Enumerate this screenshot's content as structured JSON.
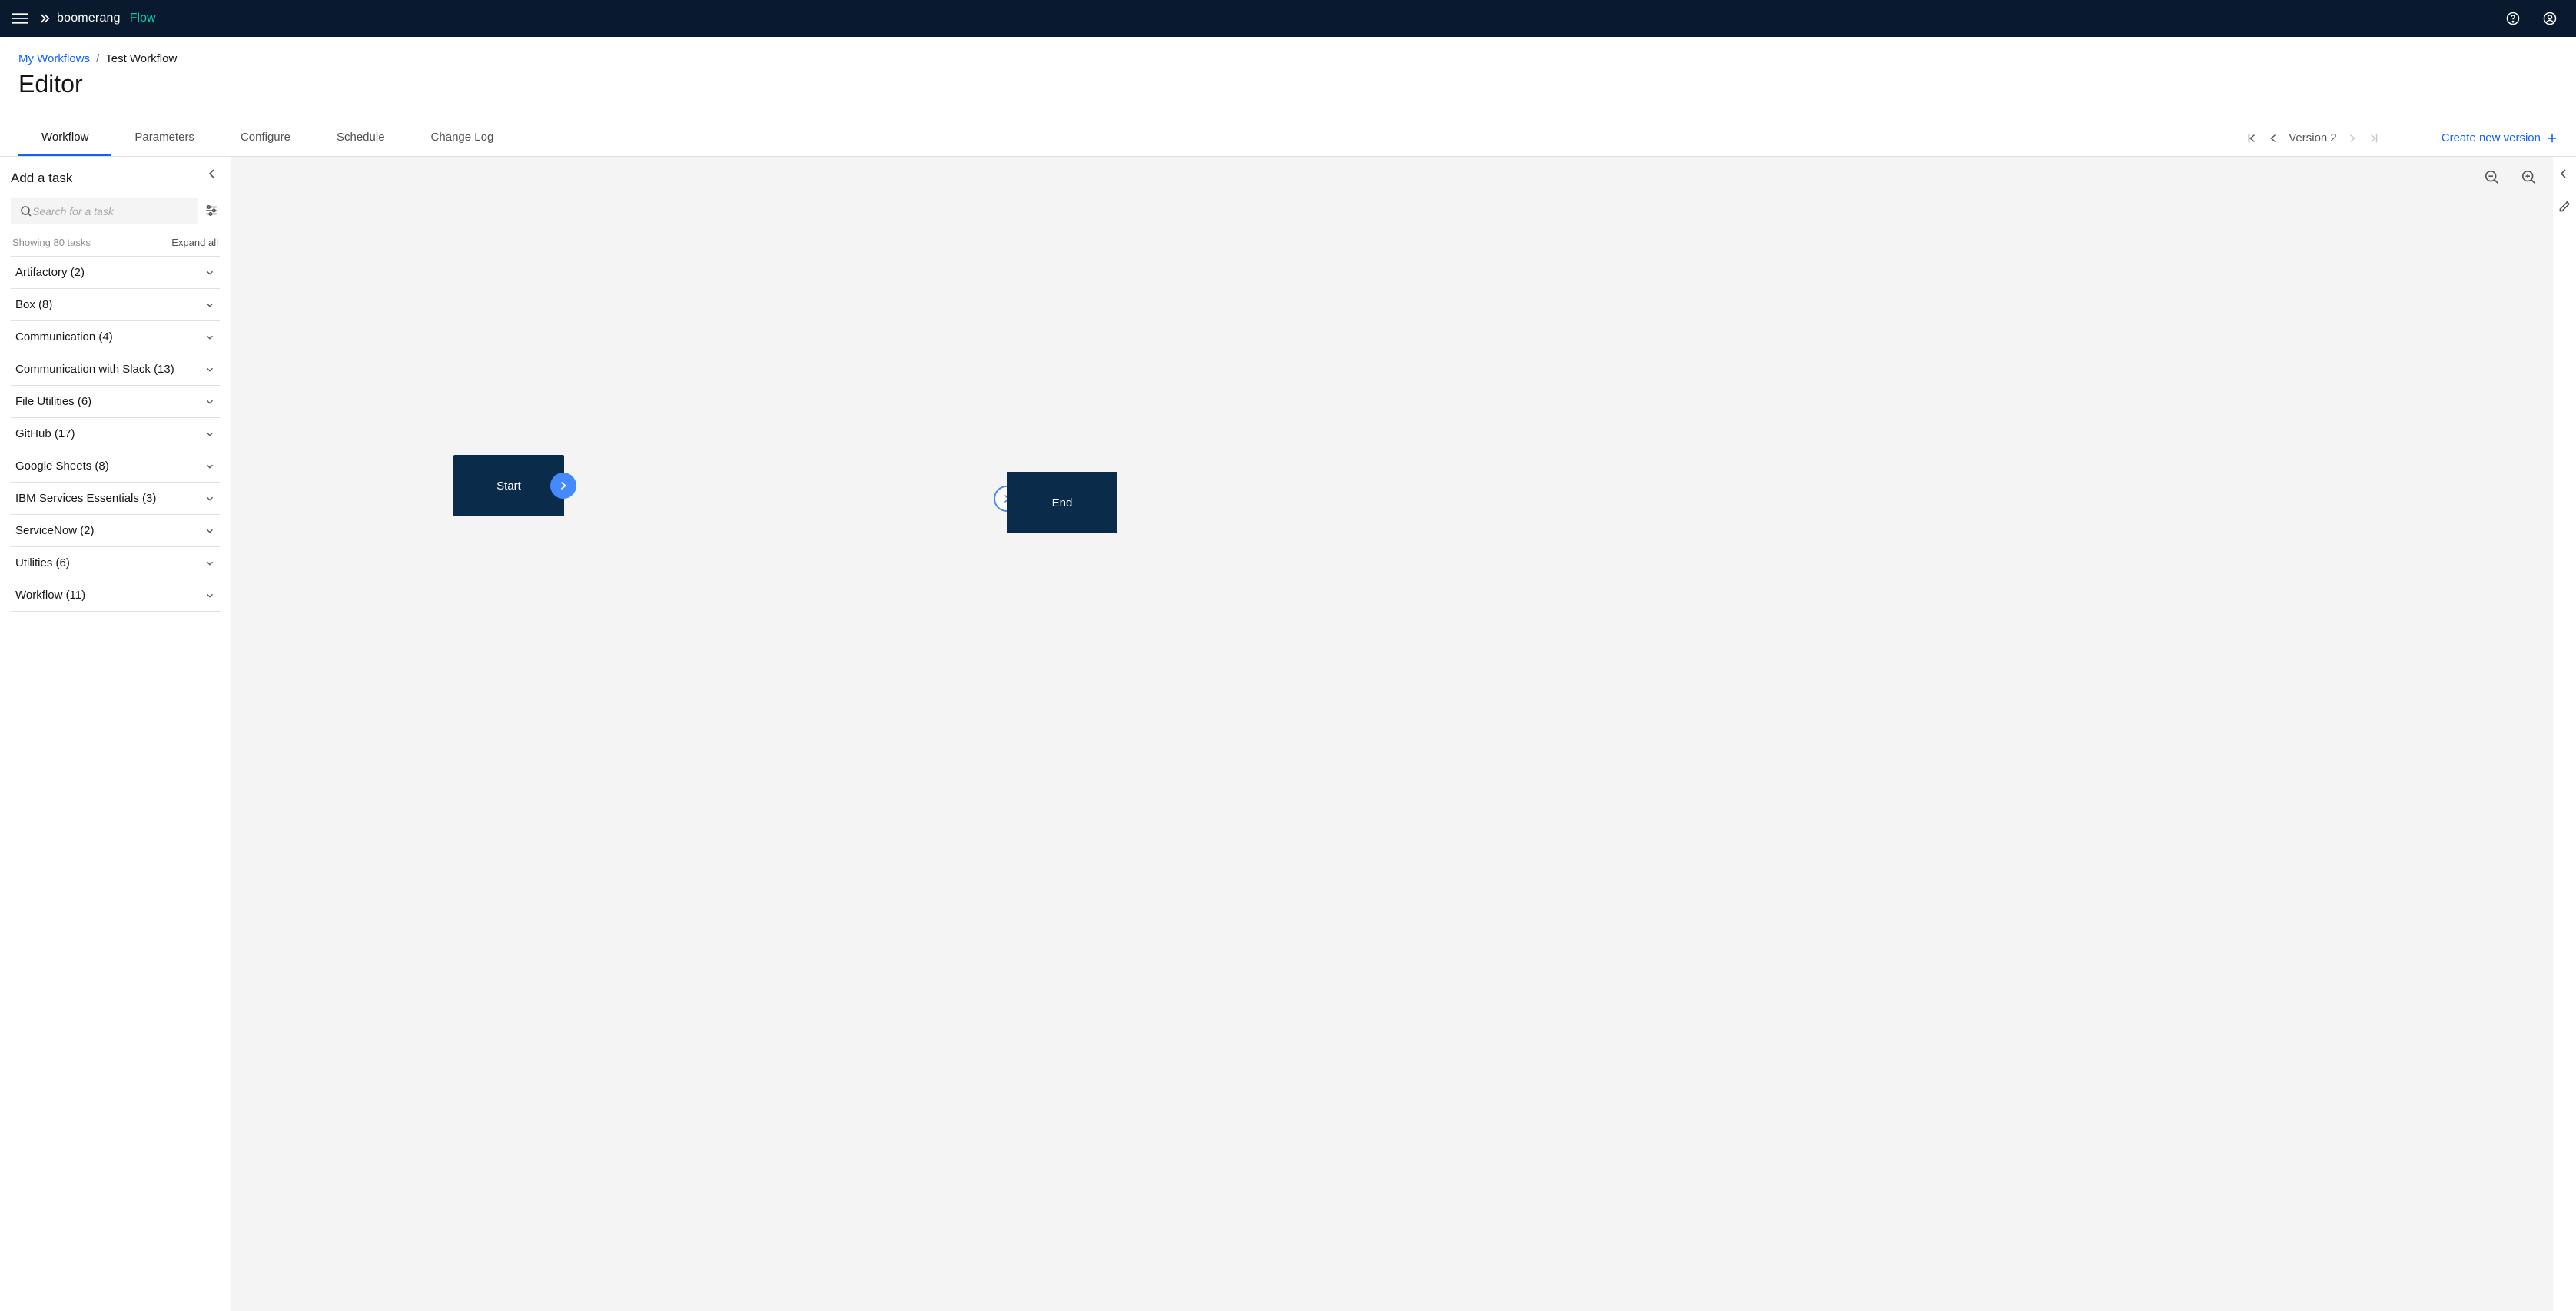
{
  "brand": {
    "name": "boomerang",
    "suffix": "Flow"
  },
  "breadcrumb": {
    "root": "My Workflows",
    "sep": "/",
    "current": "Test Workflow"
  },
  "page_title": "Editor",
  "tabs": [
    {
      "label": "Workflow",
      "active": true
    },
    {
      "label": "Parameters"
    },
    {
      "label": "Configure"
    },
    {
      "label": "Schedule"
    },
    {
      "label": "Change Log"
    }
  ],
  "version": {
    "label": "Version 2",
    "create": "Create new version"
  },
  "sidebar": {
    "title": "Add a task",
    "search_placeholder": "Search for a task",
    "showing": "Showing 80 tasks",
    "expand": "Expand all",
    "categories": [
      {
        "label": "Artifactory (2)"
      },
      {
        "label": "Box (8)"
      },
      {
        "label": "Communication (4)"
      },
      {
        "label": "Communication with Slack (13)"
      },
      {
        "label": "File Utilities (6)"
      },
      {
        "label": "GitHub (17)"
      },
      {
        "label": "Google Sheets (8)"
      },
      {
        "label": "IBM Services Essentials (3)"
      },
      {
        "label": "ServiceNow (2)"
      },
      {
        "label": "Utilities (6)"
      },
      {
        "label": "Workflow (11)"
      }
    ]
  },
  "nodes": {
    "start": "Start",
    "end": "End"
  }
}
